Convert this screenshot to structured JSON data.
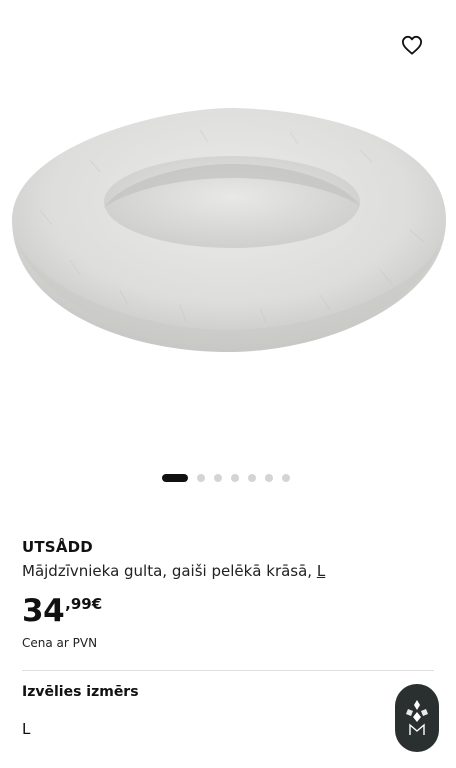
{
  "product": {
    "name": "UTSÅDD",
    "description": "Mājdzīvnieka gulta, gaiši pelēkā krāsā,",
    "size_link": "L",
    "price_integer": "34",
    "price_decimal": ",99€",
    "vat_note": "Cena ar PVN"
  },
  "gallery": {
    "image_count": 7,
    "active_index": 0,
    "favorite_icon": "heart-outline-icon"
  },
  "size_selector": {
    "label": "Izvēlies izmērs",
    "selected": "L"
  },
  "assistant": {
    "icon": "assistant-logo-icon"
  },
  "colors": {
    "text": "#111111",
    "dot_inactive": "#d4d4d4",
    "dot_active": "#111111",
    "badge_bg": "#2a3030"
  }
}
